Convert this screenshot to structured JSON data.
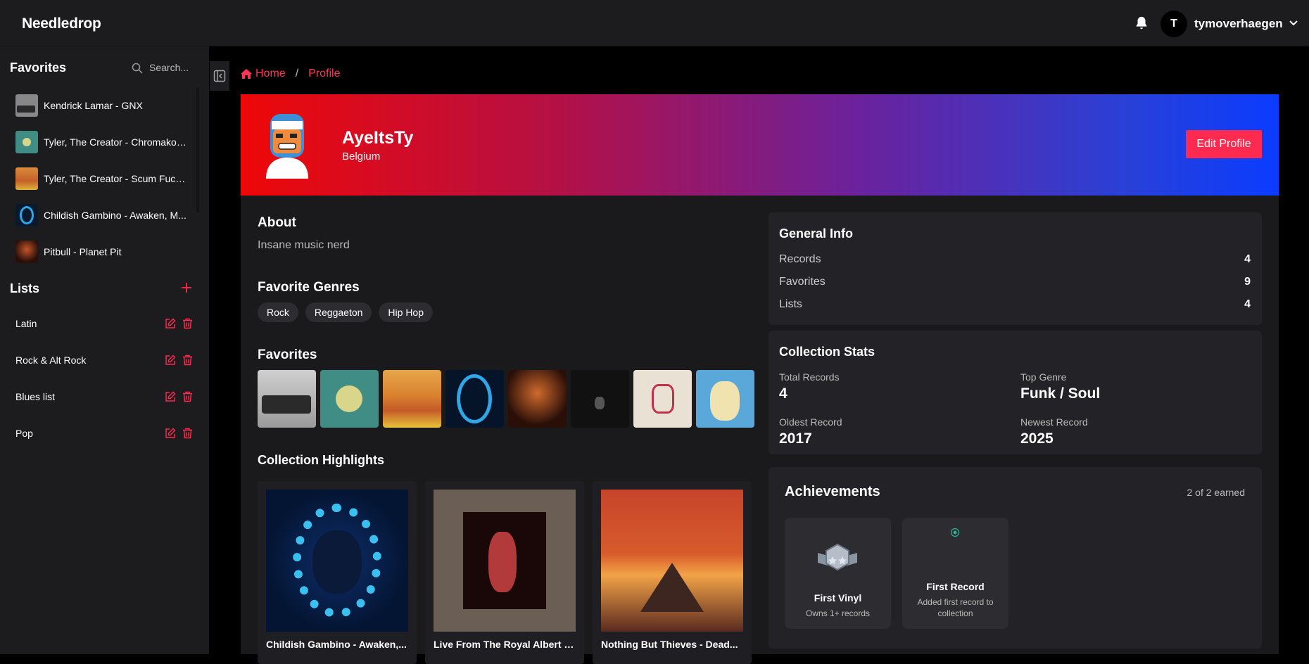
{
  "app": {
    "brand": "Needledrop"
  },
  "header": {
    "avatar_initial": "T",
    "username": "tymoverhaegen"
  },
  "sidebar": {
    "favorites_title": "Favorites",
    "search_placeholder": "Search...",
    "favorites": [
      {
        "label": "Kendrick Lamar - GNX"
      },
      {
        "label": "Tyler, The Creator - Chromakopia"
      },
      {
        "label": "Tyler, The Creator - Scum Fuck ..."
      },
      {
        "label": "Childish Gambino - Awaken, M..."
      },
      {
        "label": "Pitbull - Planet Pit"
      }
    ],
    "lists_title": "Lists",
    "lists": [
      {
        "label": "Latin"
      },
      {
        "label": "Rock & Alt Rock"
      },
      {
        "label": "Blues list"
      },
      {
        "label": "Pop"
      }
    ]
  },
  "breadcrumb": {
    "home": "Home",
    "separator": "/",
    "current": "Profile"
  },
  "profile": {
    "name": "AyeItsTy",
    "country": "Belgium",
    "edit_label": "Edit Profile"
  },
  "about": {
    "title": "About",
    "text": "Insane music nerd"
  },
  "genres": {
    "title": "Favorite Genres",
    "items": [
      "Rock",
      "Reggaeton",
      "Hip Hop"
    ]
  },
  "favorites_section": {
    "title": "Favorites"
  },
  "highlights": {
    "title": "Collection Highlights",
    "items": [
      {
        "title": "Childish Gambino - Awaken,..."
      },
      {
        "title": "Live From The Royal Albert Hall"
      },
      {
        "title": "Nothing But Thieves - Dead..."
      }
    ]
  },
  "general_info": {
    "title": "General Info",
    "rows": [
      {
        "label": "Records",
        "value": "4"
      },
      {
        "label": "Favorites",
        "value": "9"
      },
      {
        "label": "Lists",
        "value": "4"
      }
    ]
  },
  "collection_stats": {
    "title": "Collection Stats",
    "total_label": "Total Records",
    "total_value": "4",
    "genre_label": "Top Genre",
    "genre_value": "Funk / Soul",
    "oldest_label": "Oldest Record",
    "oldest_value": "2017",
    "newest_label": "Newest Record",
    "newest_value": "2025"
  },
  "achievements": {
    "title": "Achievements",
    "count": "2 of 2 earned",
    "items": [
      {
        "name": "First Vinyl",
        "desc": "Owns 1+ records"
      },
      {
        "name": "First Record",
        "desc": "Added first record to collection"
      }
    ]
  },
  "colors": {
    "accent": "#ff2a50",
    "bg": "#000000",
    "panel": "#1c1c1f"
  }
}
